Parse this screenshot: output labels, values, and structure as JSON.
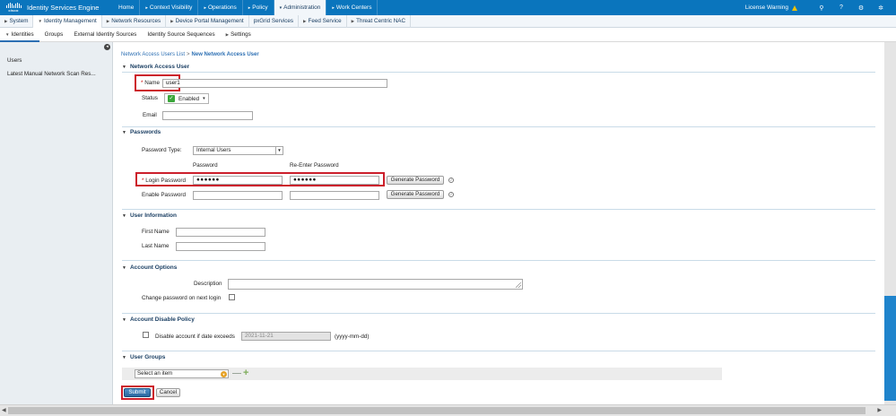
{
  "app": {
    "title": "Identity Services Engine",
    "logo_text": "cisco"
  },
  "topnav": {
    "items": [
      {
        "label": "Home",
        "caret": false,
        "active": false
      },
      {
        "label": "Context Visibility",
        "caret": true,
        "active": false
      },
      {
        "label": "Operations",
        "caret": true,
        "active": false
      },
      {
        "label": "Policy",
        "caret": true,
        "active": false
      },
      {
        "label": "Administration",
        "caret": true,
        "active": true
      },
      {
        "label": "Work Centers",
        "caret": true,
        "active": false
      }
    ],
    "license_warning": "License Warning",
    "right_icons": [
      "search-icon",
      "help-icon",
      "settings-icon",
      "gear-icon"
    ]
  },
  "subnav": {
    "items": [
      "System",
      "Identity Management",
      "Network Resources",
      "Device Portal Management",
      "pxGrid Services",
      "Feed Service",
      "Threat Centric NAC"
    ],
    "active_index": 1
  },
  "thirdnav": {
    "items": [
      "Identities",
      "Groups",
      "External Identity Sources",
      "Identity Source Sequences",
      "Settings"
    ],
    "active_index": 0
  },
  "sidebar": {
    "items": [
      "Users",
      "Latest Manual Network Scan Res..."
    ]
  },
  "breadcrumb": {
    "parent": "Network Access Users List",
    "separator": ">",
    "current": "New Network Access User"
  },
  "form": {
    "network_access_user": {
      "heading": "Network Access User",
      "name_label": "Name",
      "name_value": "user1",
      "status_label": "Status",
      "status_value": "Enabled",
      "email_label": "Email",
      "email_value": ""
    },
    "passwords": {
      "heading": "Passwords",
      "password_type_label": "Password Type:",
      "password_type_value": "Internal Users",
      "col_password": "Password",
      "col_reenter": "Re-Enter Password",
      "login_password_label": "Login Password",
      "login_password_mask": "●●●●●●",
      "login_reenter_mask": "●●●●●●",
      "enable_password_label": "Enable Password",
      "generate_label": "Generate Password"
    },
    "user_information": {
      "heading": "User Information",
      "first_name_label": "First Name",
      "last_name_label": "Last Name"
    },
    "account_options": {
      "heading": "Account Options",
      "description_label": "Description",
      "change_password_label": "Change password on next login"
    },
    "account_disable_policy": {
      "heading": "Account Disable Policy",
      "disable_label": "Disable account if date exceeds",
      "date_value": "2021-11-21",
      "date_format": "(yyyy-mm-dd)"
    },
    "user_groups": {
      "heading": "User Groups",
      "select_placeholder": "Select an item"
    },
    "submit_label": "Submit",
    "cancel_label": "Cancel"
  },
  "colors": {
    "header_blue": "#0a75bd",
    "highlight_red": "#cc1f2b",
    "scroll_thumb": "#1f84cc"
  }
}
